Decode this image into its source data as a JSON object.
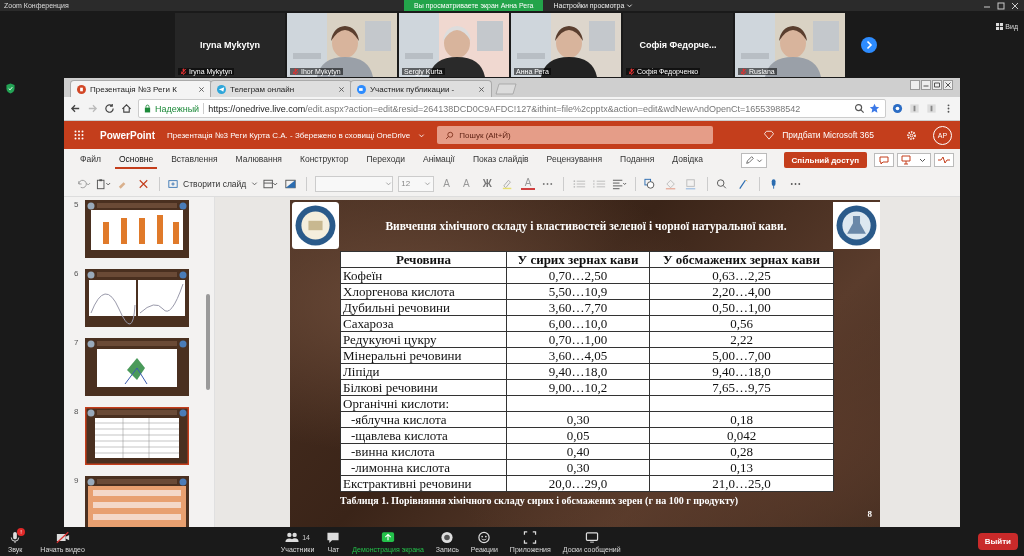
{
  "zoom": {
    "title": "Zoom Конференция",
    "share_banner": "Вы просматриваете экран Анна Рега",
    "view_settings": "Настройки просмотра",
    "view_button": "Вид"
  },
  "participants": [
    {
      "kind": "name",
      "display": "Iryna Mykytyn",
      "name": "Iryna Mykytyn",
      "muted": true
    },
    {
      "kind": "video",
      "name": "Ihor Mykytyn",
      "muted": true
    },
    {
      "kind": "video",
      "name": "Sergiy Kurta",
      "muted": false
    },
    {
      "kind": "video",
      "name": "Анна Рега",
      "muted": false
    },
    {
      "kind": "name",
      "display": "Софія Федорче...",
      "name": "Софія Федорченко",
      "muted": true
    },
    {
      "kind": "video",
      "name": "Ruslana",
      "muted": true
    }
  ],
  "browser": {
    "tabs": [
      {
        "label": "Презентація №3 Реги К",
        "kind": "ppt",
        "selected": true
      },
      {
        "label": "Телеграм онлайн",
        "kind": "telegram",
        "selected": false
      },
      {
        "label": "Участник публикации -",
        "kind": "zoom",
        "selected": false
      }
    ],
    "secure_label": "Надежный",
    "url_host": "https://onedrive.live.com",
    "url_path": "/edit.aspx?action=edit&resid=264138DCD0C9AFDC!127&ithint=file%2cpptx&action=edit&wdNewAndOpenCt=16553988542"
  },
  "ppt": {
    "app": "PowerPoint",
    "doc_title": "Презентація №3 Реги Курта С.А.  -  Збережено в сховищі OneDrive",
    "search_placeholder": "Пошук (Alt+Й)",
    "buy": "Придбати Microsoft 365",
    "avatar": "AP",
    "ribbon_tabs": [
      {
        "label": "Файл",
        "selected": false
      },
      {
        "label": "Основне",
        "selected": true
      },
      {
        "label": "Вставлення",
        "selected": false
      },
      {
        "label": "Малювання",
        "selected": false
      },
      {
        "label": "Конструктор",
        "selected": false
      },
      {
        "label": "Переходи",
        "selected": false
      },
      {
        "label": "Анімації",
        "selected": false
      },
      {
        "label": "Показ слайдів",
        "selected": false
      },
      {
        "label": "Рецензування",
        "selected": false
      },
      {
        "label": "Подання",
        "selected": false
      },
      {
        "label": "Довідка",
        "selected": false
      }
    ],
    "share": "Спільний доступ",
    "new_slide": "Створити слайд",
    "font_size": "12",
    "font_buttons": [
      "A",
      "A",
      "Ж",
      "A"
    ]
  },
  "thumbnails": [
    {
      "number": "5",
      "kind": "bar",
      "selected": false
    },
    {
      "number": "6",
      "kind": "line",
      "selected": false
    },
    {
      "number": "7",
      "kind": "radar",
      "selected": false
    },
    {
      "number": "8",
      "kind": "table",
      "selected": true
    },
    {
      "number": "9",
      "kind": "sheet",
      "selected": false
    }
  ],
  "slide": {
    "title": "Вивчення хімічного складу і властивостей зеленої і чорної натуральної кави.",
    "columns": [
      "Речовина",
      "У сирих зернах кави",
      "У обсмажених зернах кави"
    ],
    "rows": [
      {
        "indent": false,
        "cells": [
          "Кофеїн",
          "0,70…2,50",
          "0,63…2,25"
        ]
      },
      {
        "indent": false,
        "cells": [
          "Хлоргенова кислота",
          "5,50…10,9",
          "2,20…4,00"
        ]
      },
      {
        "indent": false,
        "cells": [
          "Дубильні речовини",
          "3,60…7,70",
          "0,50…1,00"
        ]
      },
      {
        "indent": false,
        "cells": [
          "Сахароза",
          "6,00…10,0",
          "0,56"
        ]
      },
      {
        "indent": false,
        "cells": [
          "Редукуючі цукру",
          "0,70…1,00",
          "2,22"
        ]
      },
      {
        "indent": false,
        "cells": [
          "Мінеральні речовини",
          "3,60…4,05",
          "5,00…7,00"
        ]
      },
      {
        "indent": false,
        "cells": [
          "Ліпіди",
          "9,40…18,0",
          "9,40…18,0"
        ]
      },
      {
        "indent": false,
        "cells": [
          "Білкові речовини",
          "9,00…10,2",
          "7,65…9,75"
        ]
      },
      {
        "indent": false,
        "cells": [
          "Органічні кислоти:"
        ]
      },
      {
        "indent": true,
        "cells": [
          "-яблучна кислота",
          "0,30",
          "0,18"
        ]
      },
      {
        "indent": true,
        "cells": [
          "-щавлева кислота",
          "0,05",
          "0,042"
        ]
      },
      {
        "indent": true,
        "cells": [
          "-винна кислота",
          "0,40",
          "0,28"
        ]
      },
      {
        "indent": true,
        "cells": [
          "-лимонна кислота",
          "0,30",
          "0,13"
        ]
      },
      {
        "indent": false,
        "cells": [
          "Екстрактивні речовини",
          "20,0…29,0",
          "21,0…25,0"
        ]
      }
    ],
    "caption": "Таблиця 1. Порівняння хімічного складу сирих і обсмажених зерен (г на 100 г продукту)",
    "page": "8"
  },
  "toolbar": [
    {
      "kind": "mic",
      "label": "Звук",
      "badge": "!"
    },
    {
      "kind": "video",
      "label": "Начать видео"
    },
    {
      "kind": "people",
      "label": "Участники",
      "count": "14"
    },
    {
      "kind": "chat",
      "label": "Чат"
    },
    {
      "kind": "share",
      "label": "Демонстрация экрана"
    },
    {
      "kind": "record",
      "label": "Запись"
    },
    {
      "kind": "react",
      "label": "Реакции"
    },
    {
      "kind": "apps",
      "label": "Приложения"
    },
    {
      "kind": "board",
      "label": "Доски сообщений"
    }
  ],
  "leave": "Выйти"
}
